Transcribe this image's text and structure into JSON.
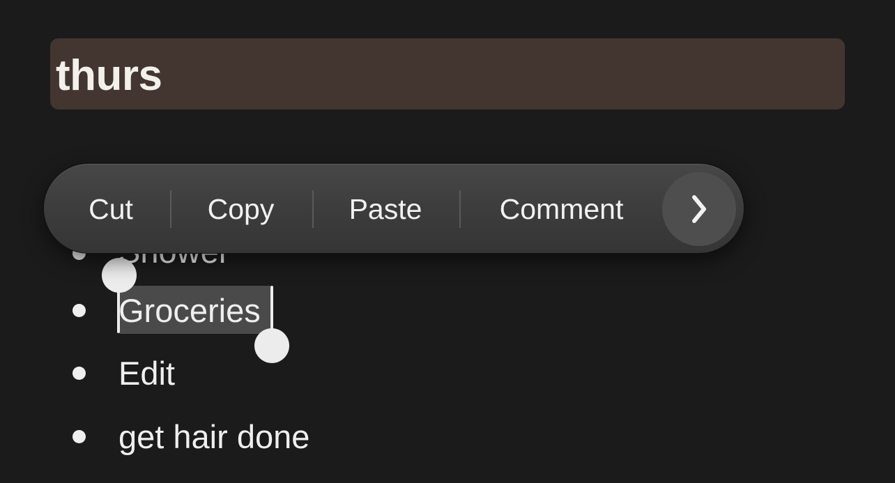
{
  "note": {
    "title": "thurs",
    "items": [
      {
        "text": "Shower"
      },
      {
        "text": "Groceries"
      },
      {
        "text": "Edit"
      },
      {
        "text": "get hair done"
      }
    ],
    "selected_text": "Groceries"
  },
  "context_menu": {
    "items": [
      {
        "label": "Cut"
      },
      {
        "label": "Copy"
      },
      {
        "label": "Paste"
      },
      {
        "label": "Comment"
      }
    ],
    "more_icon": "chevron-right-icon"
  },
  "colors": {
    "background": "#1b1b1b",
    "title_highlight": "#433630",
    "selection": "#4a4a4a",
    "menu": "#3e3e3e",
    "text": "#efefef"
  }
}
